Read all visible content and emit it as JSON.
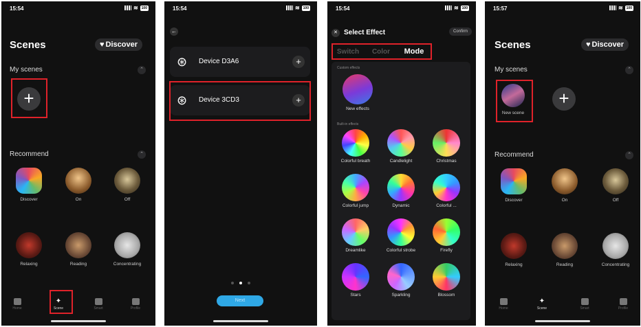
{
  "panel1": {
    "status_time": "15:54",
    "title": "Scenes",
    "discover_label": "Discover",
    "my_scenes_label": "My scenes",
    "recommend_label": "Recommend",
    "recommend": [
      {
        "label": "Discover"
      },
      {
        "label": "On"
      },
      {
        "label": "Off"
      },
      {
        "label": "Relaxing"
      },
      {
        "label": "Reading"
      },
      {
        "label": "Concentrating"
      }
    ],
    "tabs": [
      "Home",
      "Scene",
      "Smart",
      "Profile"
    ]
  },
  "panel2": {
    "status_time": "15:54",
    "devices": [
      {
        "name": "Device D3A6"
      },
      {
        "name": "Device 3CD3"
      }
    ],
    "next_label": "Next"
  },
  "panel3": {
    "status_time": "15:54",
    "title": "Select Effect",
    "confirm_label": "Confirm",
    "tabs": [
      "Switch",
      "Color",
      "Mode"
    ],
    "custom_label": "Custom effects",
    "new_effects_label": "New effects",
    "builtin_label": "Built-in effects",
    "effects": [
      "Colorful breath",
      "Candlelight",
      "Christmas",
      "Colorful jump",
      "Dynamic",
      "Colorful ...",
      "Dreamlike",
      "Colorful strobe",
      "Firefly",
      "Stars",
      "Sparkling",
      "Blossom"
    ]
  },
  "panel4": {
    "status_time": "15:57",
    "title": "Scenes",
    "discover_label": "Discover",
    "my_scenes_label": "My scenes",
    "new_scene_label": "New scene",
    "recommend_label": "Recommend",
    "recommend": [
      {
        "label": "Discover"
      },
      {
        "label": "On"
      },
      {
        "label": "Off"
      },
      {
        "label": "Relaxing"
      },
      {
        "label": "Reading"
      },
      {
        "label": "Concentrating"
      }
    ],
    "tabs": [
      "Home",
      "Scene",
      "Smart",
      "Profile"
    ]
  },
  "battery_label": "100",
  "colors": {
    "highlight": "#e0222a",
    "accent": "#2fa8e6"
  }
}
